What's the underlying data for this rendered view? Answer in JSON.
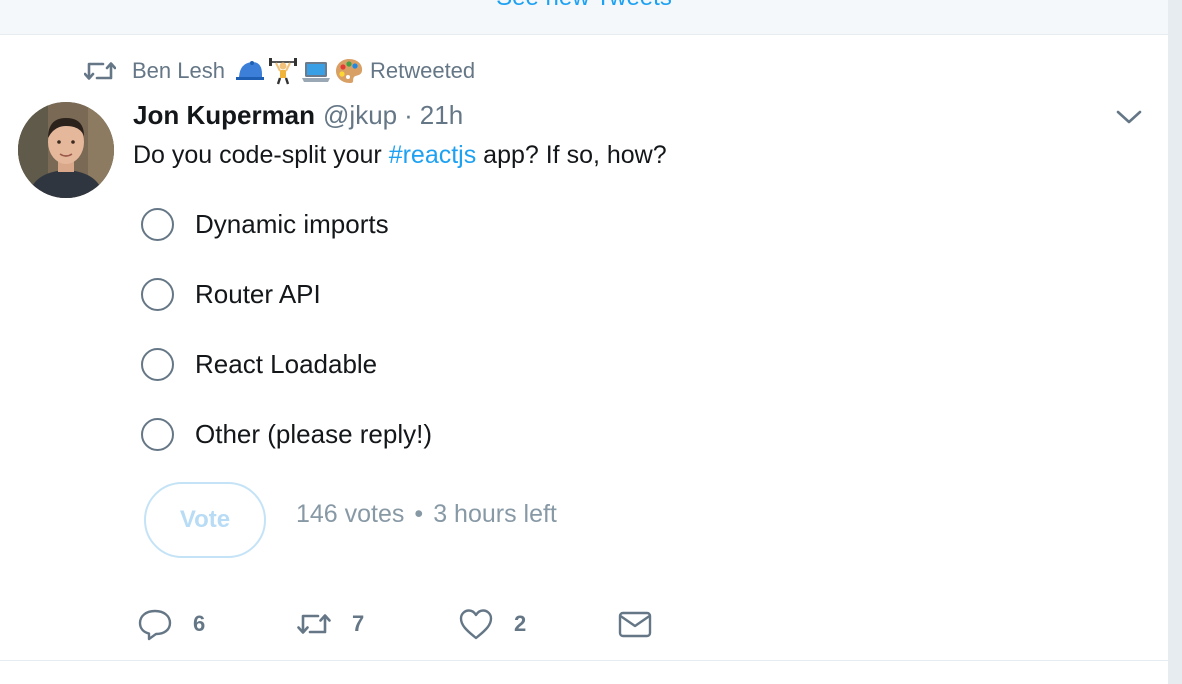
{
  "banner": {
    "text": "See new Tweets"
  },
  "retweet_context": {
    "icon": "retweet-icon",
    "name": "Ben Lesh",
    "emojis": [
      "blue-cap-emoji",
      "weightlifter-emoji",
      "laptop-emoji",
      "palette-emoji"
    ],
    "label": "Retweeted"
  },
  "tweet": {
    "avatar": "profile-photo",
    "fullname": "Jon Kuperman",
    "handle": "@jkup",
    "separator": "·",
    "time": "21h",
    "text_before": "Do you code-split your ",
    "hashtag": "#reactjs",
    "text_after": " app? If so, how?",
    "menu_icon": "chevron-down-icon"
  },
  "poll": {
    "options": [
      {
        "label": "Dynamic imports"
      },
      {
        "label": "Router API"
      },
      {
        "label": "React Loadable"
      },
      {
        "label": "Other (please reply!)"
      }
    ],
    "vote_label": "Vote",
    "votes": "146 votes",
    "bullet": "•",
    "time_left": "3 hours left"
  },
  "actions": {
    "reply": {
      "icon": "reply-icon",
      "count": "6"
    },
    "retweet": {
      "icon": "retweet-icon",
      "count": "7"
    },
    "like": {
      "icon": "heart-icon",
      "count": "2"
    },
    "dm": {
      "icon": "envelope-icon"
    }
  },
  "colors": {
    "accent": "#1da1f2",
    "secondary_text": "#657786",
    "vote_border": "#c5e3f7"
  }
}
